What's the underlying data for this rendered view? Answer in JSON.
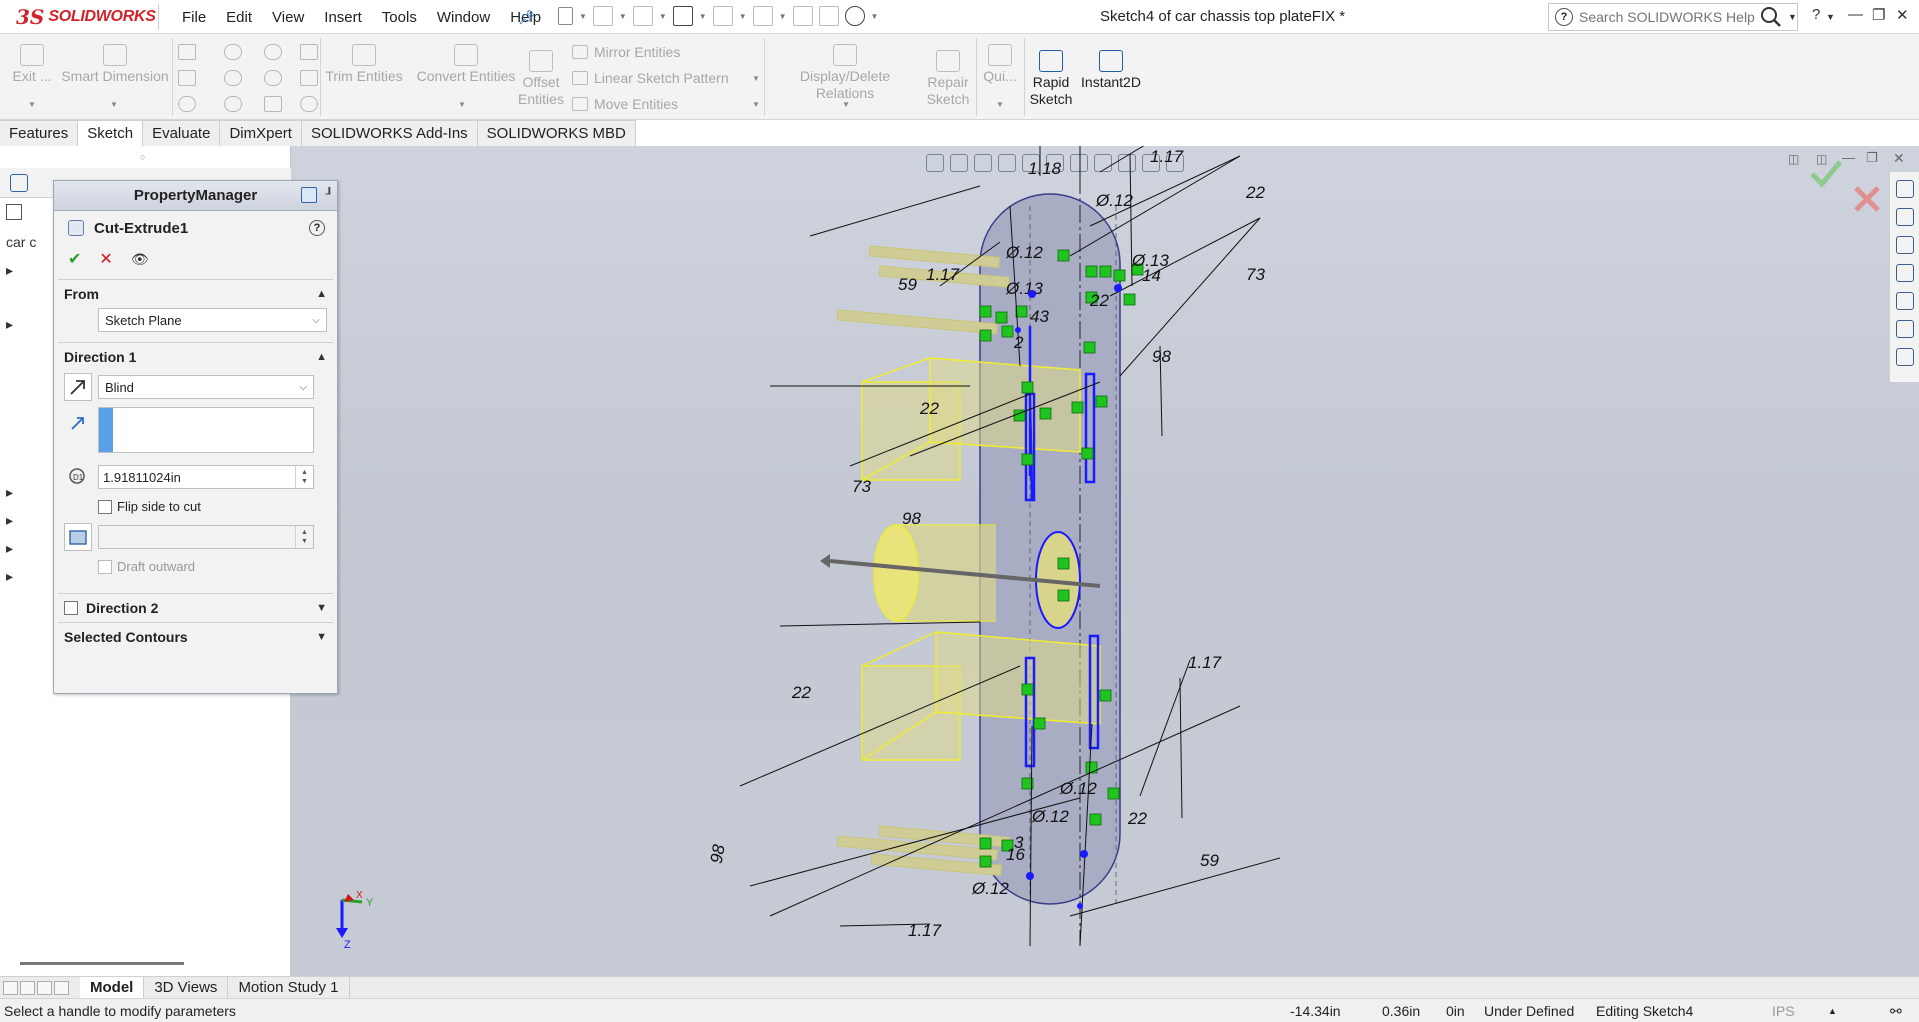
{
  "app": {
    "logo_mark": "3S",
    "logo_text": "SOLIDWORKS",
    "document_title": "Sketch4 of car chassis top plateFIX *"
  },
  "menu": {
    "items": [
      "File",
      "Edit",
      "View",
      "Insert",
      "Tools",
      "Window",
      "Help"
    ]
  },
  "search": {
    "placeholder": "Search SOLIDWORKS Help"
  },
  "command_manager": {
    "exit_sketch": "Exit ...",
    "smart_dimension": "Smart Dimension",
    "trim_entities": "Trim Entities",
    "convert_entities": "Convert Entities",
    "offset_entities_1": "Offset",
    "offset_entities_2": "Entities",
    "mirror_entities": "Mirror Entities",
    "linear_sketch_pattern": "Linear Sketch Pattern",
    "move_entities": "Move Entities",
    "display_delete_relations": "Display/Delete Relations",
    "repair_sketch_1": "Repair",
    "repair_sketch_2": "Sketch",
    "quick_snaps": "Qui...",
    "rapid_sketch_1": "Rapid",
    "rapid_sketch_2": "Sketch",
    "instant2d": "Instant2D"
  },
  "tabs": [
    "Features",
    "Sketch",
    "Evaluate",
    "DimXpert",
    "SOLIDWORKS Add-Ins",
    "SOLIDWORKS MBD"
  ],
  "tree": {
    "root_label": "car c"
  },
  "property_manager": {
    "title": "PropertyManager",
    "feature_name": "Cut-Extrude1",
    "from": {
      "label": "From",
      "value": "Sketch Plane"
    },
    "direction1": {
      "label": "Direction 1",
      "end_condition": "Blind",
      "depth": "1.91811024in",
      "flip_side_label": "Flip side to cut",
      "draft_outward_label": "Draft outward"
    },
    "direction2": {
      "label": "Direction 2"
    },
    "selected_contours": {
      "label": "Selected Contours"
    }
  },
  "dimensions": {
    "d_118": "1.18",
    "d_012": "Ø.12",
    "d_117": "1.17",
    "d_22": "22",
    "d_73": "73",
    "d_98": "98",
    "d_59": "59",
    "d_013": "Ø.13",
    "d_14": "14",
    "d_43": "43",
    "d_2": "2",
    "d_3": "3",
    "d_16": "16"
  },
  "bottom_tabs": [
    "Model",
    "3D Views",
    "Motion Study 1"
  ],
  "status": {
    "message": "Select a handle to modify parameters",
    "x": "-14.34in",
    "y": "0.36in",
    "z": "0in",
    "definition": "Under Defined",
    "editing": "Editing Sketch4",
    "units": "IPS"
  },
  "triad": {
    "x_label": "X",
    "y_label": "Y",
    "z_label": "Z"
  },
  "colors": {
    "brand_red": "#d3222a",
    "sketch_blue": "#1a1aff",
    "relation_green": "#1fc41f",
    "body_yellow": "#e8e37a",
    "plate_gray": "#a9adc4"
  }
}
